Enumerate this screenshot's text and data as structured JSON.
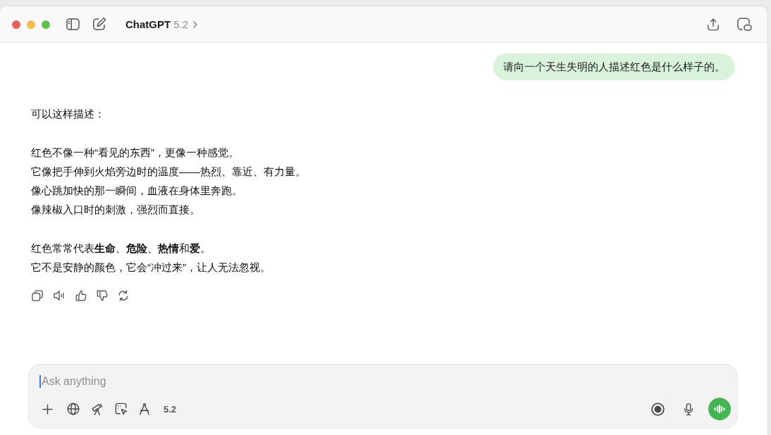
{
  "window": {
    "title": "ChatGPT",
    "model_version": "5.2"
  },
  "conversation": {
    "user_message": "请向一个天生失明的人描述红色是什么样子的。",
    "assistant_message": {
      "paragraphs": [
        {
          "lines": [
            "可以这样描述："
          ]
        },
        {
          "lines": [
            "红色不像一种“看见的东西”，更像一种感觉。",
            "它像把手伸到火焰旁边时的温度——热烈、靠近、有力量。",
            "像心跳加快的那一瞬间，血液在身体里奔跑。",
            "像辣椒入口时的刺激，强烈而直接。"
          ]
        },
        {
          "lines": [
            "红色常常代表**生命**、**危险**、**热情**和**爱**。",
            "它不是安静的颜色，它会“冲过来”，让人无法忽视。"
          ]
        }
      ]
    }
  },
  "composer": {
    "placeholder": "Ask anything",
    "focused": true,
    "model_version": "5.2"
  }
}
